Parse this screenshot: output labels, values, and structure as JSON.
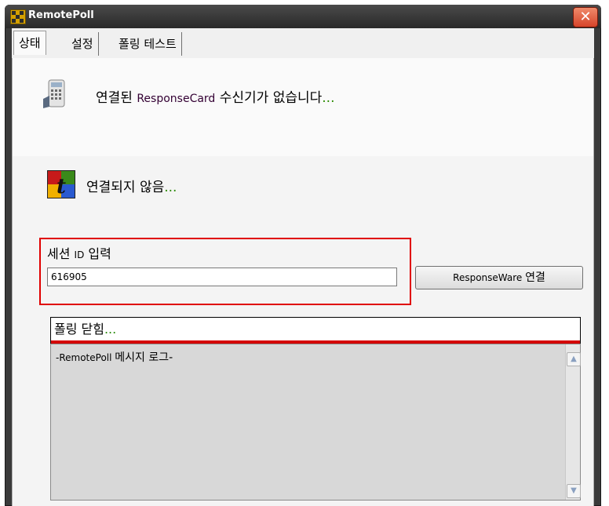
{
  "window": {
    "title": "RemotePoll",
    "close_glyph": "✕"
  },
  "tabs": [
    {
      "label": "상태"
    },
    {
      "label": "설정"
    },
    {
      "label": "폴링 테스트"
    }
  ],
  "status": {
    "receiver_prefix": "연결된 ",
    "receiver_product": "ResponseCard",
    "receiver_suffix": " 수신기가 없습니다",
    "receiver_dots": "...",
    "connection_text": "연결되지 않음",
    "connection_dots": "..."
  },
  "session": {
    "label_prefix": "세션 ",
    "label_id": "ID",
    "label_suffix": " 입력",
    "value": "616905",
    "connect_button_prefix": "ResponseWare ",
    "connect_button_suffix": "연결"
  },
  "poll": {
    "status_text": "폴링 닫힘",
    "status_dots": "...",
    "log_prefix": "-RemotePoll ",
    "log_suffix": "메시지 로그-",
    "scroll_up_glyph": "▲",
    "scroll_down_glyph": "▼"
  },
  "colors": {
    "highlight_border": "#e00000",
    "ellipsis": "#2a8a00",
    "poll_bar": "#d40000"
  }
}
